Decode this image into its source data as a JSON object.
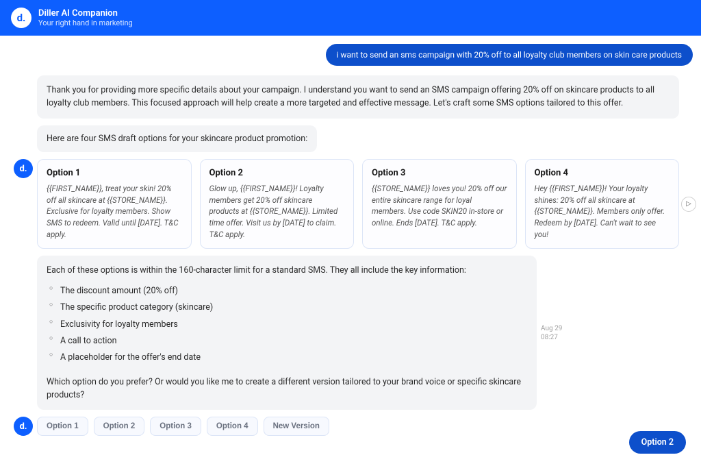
{
  "header": {
    "logo_text": "d.",
    "title": "Diller AI Companion",
    "subtitle": "Your right hand in marketing"
  },
  "user_message": "i want to send an sms campaign with 20% off to all loyalty club members on skin care products",
  "ai": {
    "intro": "Thank you for providing more specific details about your campaign. I understand you want to send an SMS campaign offering 20% off on skincare products to all loyalty club members. This focused approach will help create a more targeted and effective message. Let's craft some SMS options tailored to this offer.",
    "lead_in": "Here are four SMS draft options for your skincare product promotion:",
    "options": [
      {
        "title": "Option 1",
        "body": "{{FIRST_NAME}}, treat your skin! 20% off all skincare at {{STORE_NAME}}. Exclusive for loyalty members. Show SMS to redeem. Valid until [DATE]. T&C apply."
      },
      {
        "title": "Option 2",
        "body": "Glow up, {{FIRST_NAME}}! Loyalty members get 20% off skincare products at {{STORE_NAME}}. Limited time offer. Visit us by [DATE] to claim. T&C apply."
      },
      {
        "title": "Option 3",
        "body": "{{STORE_NAME}} loves you! 20% off our entire skincare range for loyal members. Use code SKIN20 in-store or online. Ends [DATE]. T&C apply."
      },
      {
        "title": "Option 4",
        "body": "Hey {{FIRST_NAME}}! Your loyalty shines: 20% off all skincare at {{STORE_NAME}}. Members only offer. Redeem by [DATE]. Can't wait to see you!"
      }
    ],
    "summary_intro": "Each of these options is within the 160-character limit for a standard SMS. They all include the key information:",
    "summary_bullets": [
      "The discount amount (20% off)",
      "The specific product category (skincare)",
      "Exclusivity for loyalty members",
      "A call to action",
      "A placeholder for the offer's end date"
    ],
    "closing_question": "Which option do you prefer? Or would you like me to create a different version tailored to your brand voice or specific skincare products?"
  },
  "timestamp": {
    "date": "Aug 29",
    "time": "08:27"
  },
  "choice_chips": [
    "Option 1",
    "Option 2",
    "Option 3",
    "Option 4",
    "New Version"
  ],
  "selected_reply": "Option 2",
  "avatar_glyph": "d.",
  "scroll_glyph": "▷"
}
